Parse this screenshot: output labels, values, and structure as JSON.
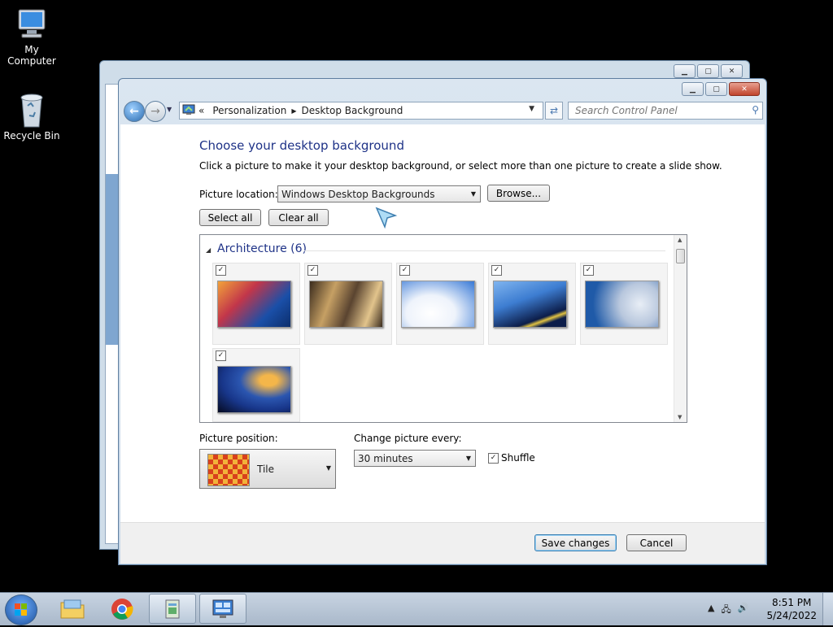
{
  "desktop": {
    "icons": [
      {
        "label": "My Computer"
      },
      {
        "label": "Recycle Bin"
      }
    ]
  },
  "window": {
    "address": {
      "overflow": "«",
      "crumbs": [
        "Personalization",
        "Desktop Background"
      ]
    },
    "search_placeholder": "Search Control Panel",
    "title": "Choose your desktop background",
    "subtitle": "Click a picture to make it your desktop background, or select more than one picture to create a slide show.",
    "picture_location_label": "Picture location:",
    "picture_location_value": "Windows Desktop Backgrounds",
    "browse_label": "Browse...",
    "select_all_label": "Select all",
    "clear_all_label": "Clear all",
    "group": {
      "title": "Architecture (6)",
      "items": [
        {
          "checked": true,
          "colors": [
            "#f2a23a",
            "#1a4fa8"
          ]
        },
        {
          "checked": true,
          "colors": [
            "#c6a064",
            "#3b2c1e"
          ]
        },
        {
          "checked": true,
          "colors": [
            "#eef3fb",
            "#3778d6"
          ]
        },
        {
          "checked": true,
          "colors": [
            "#3d7dd1",
            "#0c1d49"
          ]
        },
        {
          "checked": true,
          "colors": [
            "#b8c7dd",
            "#1f5aa8"
          ]
        },
        {
          "checked": true,
          "colors": [
            "#18368a",
            "#f4b64a"
          ]
        }
      ]
    },
    "picture_position_label": "Picture position:",
    "picture_position_value": "Tile",
    "change_every_label": "Change picture every:",
    "change_every_value": "30 minutes",
    "shuffle_label": "Shuffle",
    "shuffle_checked": true,
    "save_label": "Save changes",
    "cancel_label": "Cancel"
  },
  "taskbar": {
    "time": "8:51 PM",
    "date": "5/24/2022"
  }
}
